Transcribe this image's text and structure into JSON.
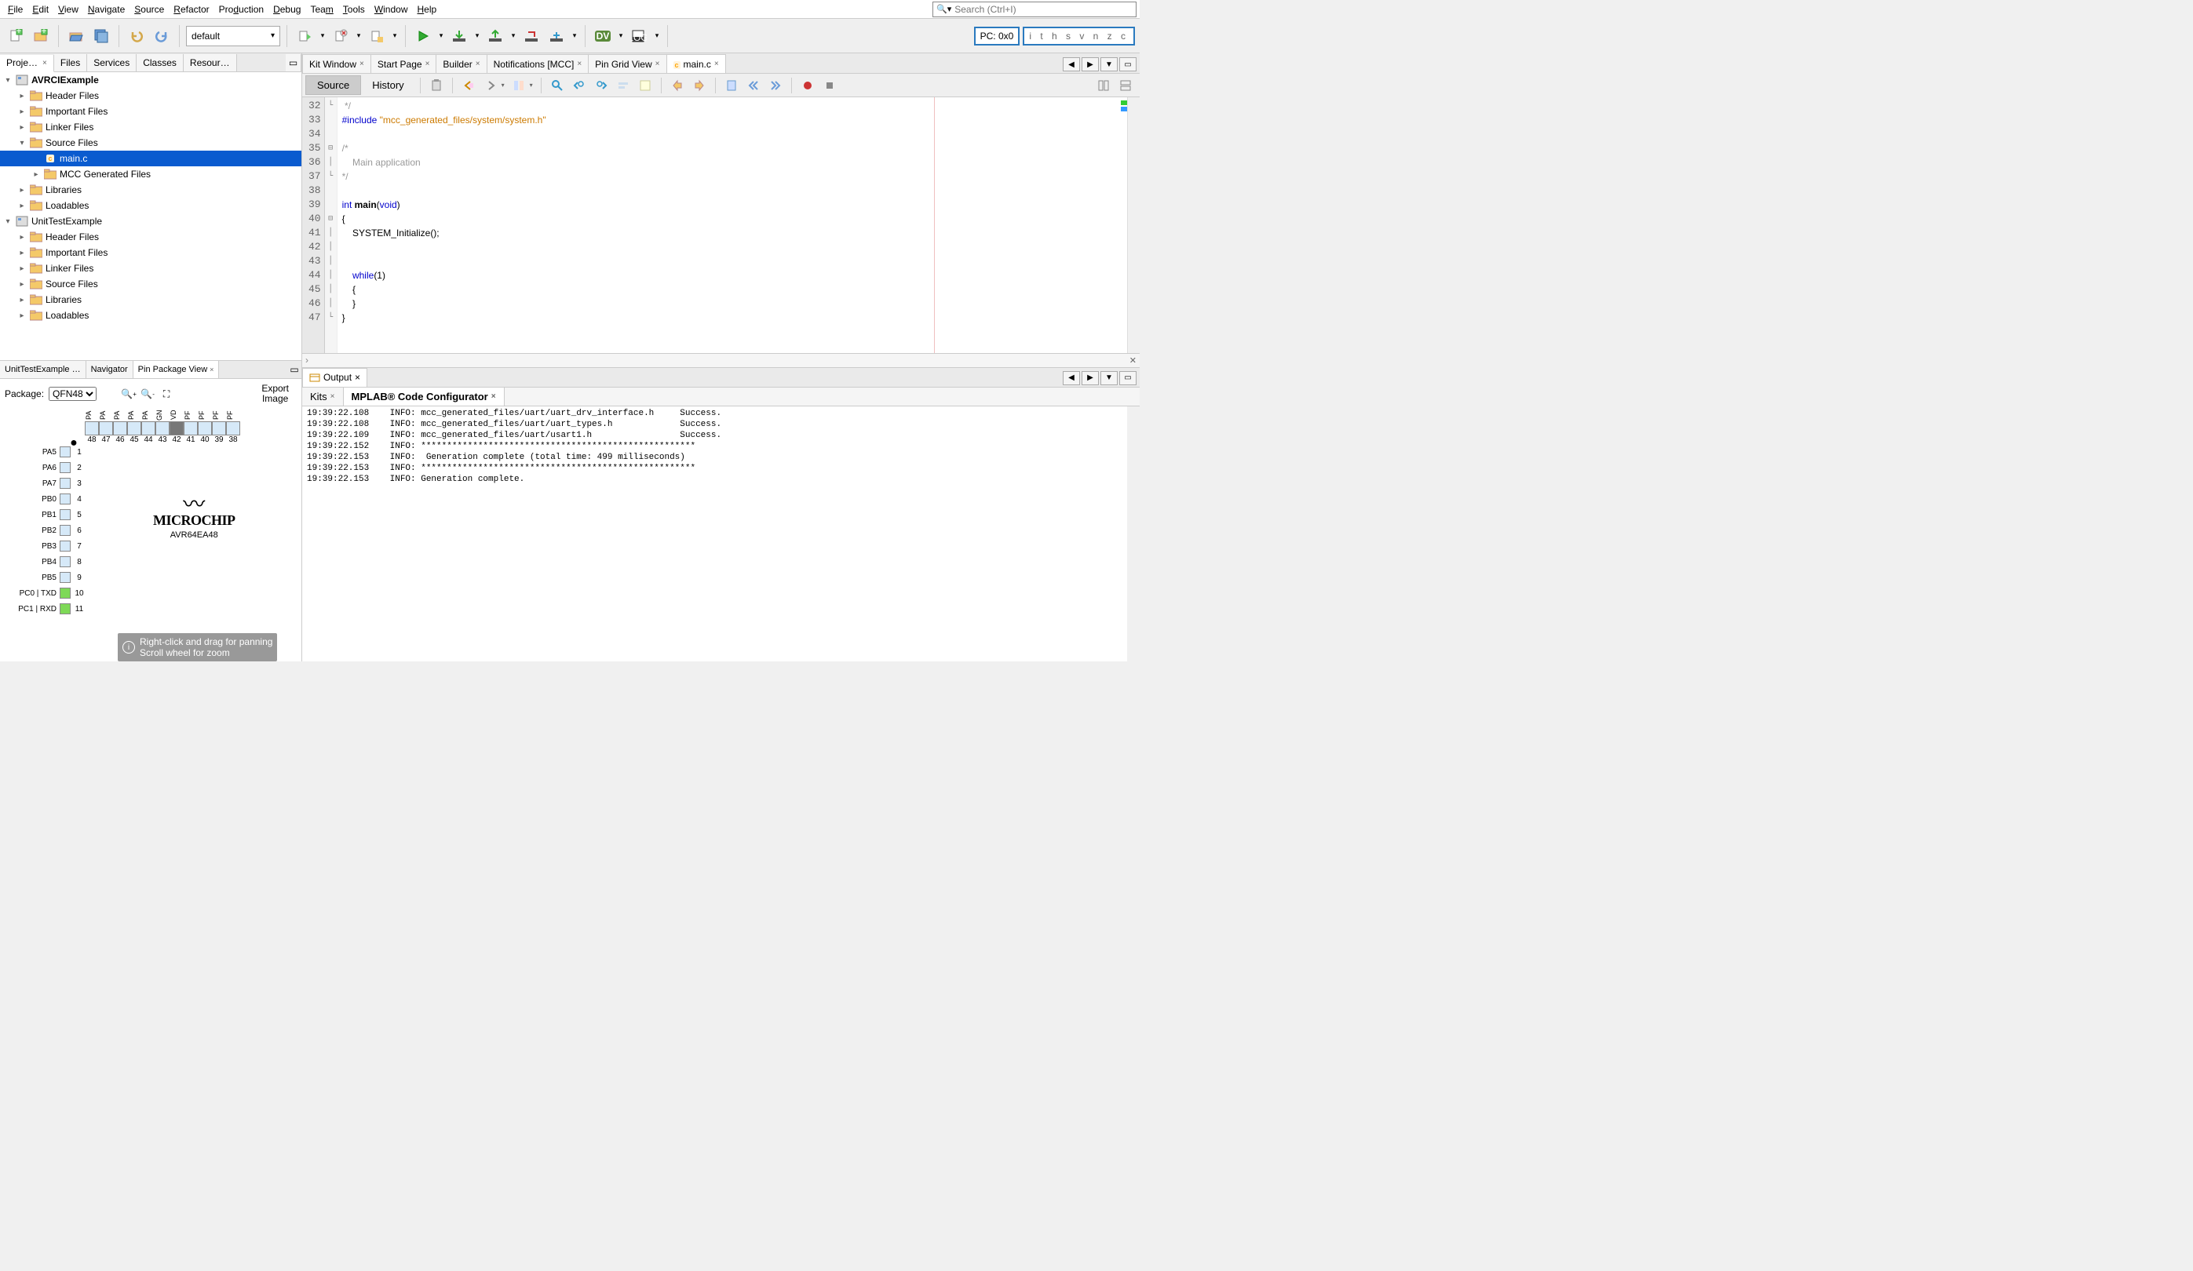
{
  "menu": [
    "File",
    "Edit",
    "View",
    "Navigate",
    "Source",
    "Refactor",
    "Production",
    "Debug",
    "Team",
    "Tools",
    "Window",
    "Help"
  ],
  "search_placeholder": "Search (Ctrl+I)",
  "toolbar": {
    "config_combo": "default",
    "pc": "PC: 0x0",
    "flags": "i t h s v n z c"
  },
  "left_tabs": [
    "Proje…",
    "Files",
    "Services",
    "Classes",
    "Resour…"
  ],
  "tree": [
    {
      "d": 0,
      "tw": "▾",
      "icon": "proj",
      "label": "AVRCIExample",
      "bold": true
    },
    {
      "d": 1,
      "tw": "▸",
      "icon": "folder",
      "label": "Header Files"
    },
    {
      "d": 1,
      "tw": "▸",
      "icon": "folder",
      "label": "Important Files"
    },
    {
      "d": 1,
      "tw": "▸",
      "icon": "folder",
      "label": "Linker Files"
    },
    {
      "d": 1,
      "tw": "▾",
      "icon": "folder",
      "label": "Source Files"
    },
    {
      "d": 2,
      "tw": "",
      "icon": "c",
      "label": "main.c",
      "sel": true
    },
    {
      "d": 2,
      "tw": "▸",
      "icon": "folder",
      "label": "MCC Generated Files"
    },
    {
      "d": 1,
      "tw": "▸",
      "icon": "folder",
      "label": "Libraries"
    },
    {
      "d": 1,
      "tw": "▸",
      "icon": "folder",
      "label": "Loadables"
    },
    {
      "d": 0,
      "tw": "▾",
      "icon": "proj",
      "label": "UnitTestExample"
    },
    {
      "d": 1,
      "tw": "▸",
      "icon": "folder",
      "label": "Header Files"
    },
    {
      "d": 1,
      "tw": "▸",
      "icon": "folder",
      "label": "Important Files"
    },
    {
      "d": 1,
      "tw": "▸",
      "icon": "folder",
      "label": "Linker Files"
    },
    {
      "d": 1,
      "tw": "▸",
      "icon": "folder",
      "label": "Source Files"
    },
    {
      "d": 1,
      "tw": "▸",
      "icon": "folder",
      "label": "Libraries"
    },
    {
      "d": 1,
      "tw": "▸",
      "icon": "folder",
      "label": "Loadables"
    }
  ],
  "bl_tabs": [
    "UnitTestExample …",
    "Navigator",
    "Pin Package View"
  ],
  "pin": {
    "package_label": "Package:",
    "package_value": "QFN48",
    "export": "Export\nImage",
    "top_labels": [
      "PA",
      "PA",
      "PA",
      "PA",
      "PA",
      "GN",
      "VD",
      "PF",
      "PF",
      "PF",
      "PF"
    ],
    "top_nums": [
      "48",
      "47",
      "46",
      "45",
      "44",
      "43",
      "42",
      "41",
      "40",
      "39",
      "38"
    ],
    "left": [
      {
        "l": "PA5",
        "n": "1"
      },
      {
        "l": "PA6",
        "n": "2"
      },
      {
        "l": "PA7",
        "n": "3"
      },
      {
        "l": "PB0",
        "n": "4"
      },
      {
        "l": "PB1",
        "n": "5"
      },
      {
        "l": "PB2",
        "n": "6"
      },
      {
        "l": "PB3",
        "n": "7"
      },
      {
        "l": "PB4",
        "n": "8"
      },
      {
        "l": "PB5",
        "n": "9"
      },
      {
        "l": "PC0 | TXD",
        "n": "10",
        "g": true
      },
      {
        "l": "PC1 | RXD",
        "n": "11",
        "g": true
      }
    ],
    "logo_name": "MICROCHIP",
    "logo_part": "AVR64EA48",
    "hint1": "Right-click and drag for panning",
    "hint2": "Scroll wheel for zoom"
  },
  "editor_tabs": [
    {
      "t": "Kit Window"
    },
    {
      "t": "Start Page"
    },
    {
      "t": "Builder"
    },
    {
      "t": "Notifications [MCC]"
    },
    {
      "t": "Pin Grid View"
    },
    {
      "t": "main.c",
      "active": true,
      "icon": "c"
    }
  ],
  "editor_mode": {
    "source": "Source",
    "history": "History"
  },
  "code": {
    "start": 32,
    "lines": [
      {
        "fold": "└",
        "html": "<span class='cm'> */</span>"
      },
      {
        "html": "<span class='pp'>#include</span> <span class='str'>\"mcc_generated_files/system/system.h\"</span>"
      },
      {
        "html": ""
      },
      {
        "fold": "⊟",
        "html": "<span class='cm'>/*</span>"
      },
      {
        "fold": "│",
        "html": "<span class='cm'>    Main application</span>"
      },
      {
        "fold": "└",
        "html": "<span class='cm'>*/</span>"
      },
      {
        "html": ""
      },
      {
        "html": "<span class='kw'>int</span> <span class='fn'>main</span>(<span class='kw'>void</span>)"
      },
      {
        "fold": "⊟",
        "html": "{"
      },
      {
        "fold": "│",
        "html": "    SYSTEM_Initialize();"
      },
      {
        "fold": "│",
        "html": ""
      },
      {
        "fold": "│",
        "html": ""
      },
      {
        "fold": "│",
        "html": "    <span class='kw'>while</span>(1)"
      },
      {
        "fold": "│",
        "html": "    {"
      },
      {
        "fold": "│",
        "html": "    }"
      },
      {
        "fold": "└",
        "html": "}"
      }
    ]
  },
  "output_tab": "Output",
  "output_subtabs": [
    {
      "t": "Kits"
    },
    {
      "t": "MPLAB® Code Configurator",
      "active": true
    }
  ],
  "output_lines": [
    "19:39:22.108    INFO: mcc_generated_files/uart/uart_drv_interface.h     Success.",
    "19:39:22.108    INFO: mcc_generated_files/uart/uart_types.h             Success.",
    "19:39:22.109    INFO: mcc_generated_files/uart/usart1.h                 Success.",
    "19:39:22.152    INFO: *****************************************************",
    "19:39:22.153    INFO:  Generation complete (total time: 499 milliseconds)",
    "19:39:22.153    INFO: *****************************************************",
    "19:39:22.153    INFO: Generation complete."
  ]
}
